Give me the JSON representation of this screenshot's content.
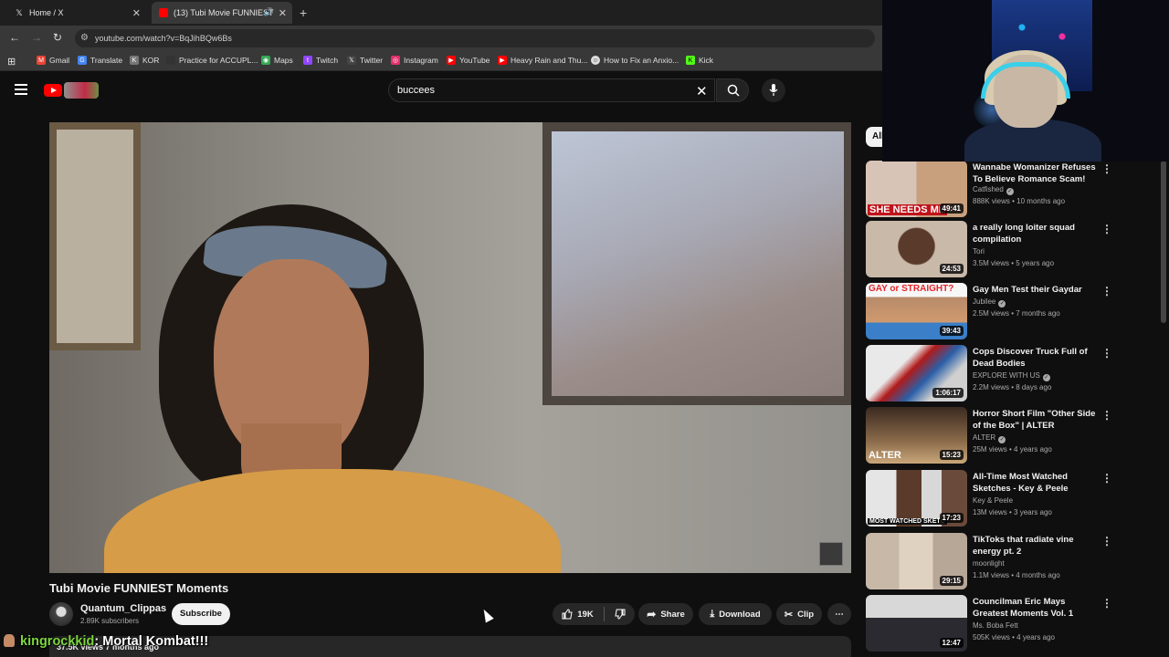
{
  "browser": {
    "tabs": [
      {
        "label": "Home / X"
      },
      {
        "label": "(13) Tubi Movie FUNNIEST"
      }
    ],
    "url": "youtube.com/watch?v=BqJihBQw6Bs",
    "bookmarks": [
      {
        "label": "Gmail",
        "color": "#ea4335"
      },
      {
        "label": "Translate",
        "color": "#4285f4"
      },
      {
        "label": "KOR",
        "color": "#777777"
      },
      {
        "label": "Practice for ACCUPL...",
        "color": "#333333"
      },
      {
        "label": "Maps",
        "color": "#34a853"
      },
      {
        "label": "Twitch",
        "color": "#9146ff"
      },
      {
        "label": "Twitter",
        "color": "#444444"
      },
      {
        "label": "Instagram",
        "color": "#e1306c"
      },
      {
        "label": "YouTube",
        "color": "#ff0000"
      },
      {
        "label": "Heavy Rain and Thu...",
        "color": "#ff0000"
      },
      {
        "label": "How to Fix an Anxio...",
        "color": "#dddddd"
      },
      {
        "label": "Kick",
        "color": "#53fc18"
      }
    ]
  },
  "youtube": {
    "search_value": "buccees",
    "video": {
      "title": "Tubi Movie FUNNIEST Moments",
      "channel": "Quantum_Clippas",
      "subscribers": "2.89K subscribers",
      "subscribe_label": "Subscribe",
      "likes": "19K",
      "share_label": "Share",
      "download_label": "Download",
      "clip_label": "Clip",
      "views_line": "37.5K views  7 months ago"
    },
    "chip_all": "All",
    "recommendations": [
      {
        "title": "Wannabe Womanizer Refuses To Believe Romance Scam!",
        "channel": "Catfished",
        "verified": true,
        "meta": "888K views • 10 months ago",
        "duration": "49:41",
        "thumb_text": "SHE NEEDS ME"
      },
      {
        "title": "a really long loiter squad compilation",
        "channel": "Tori",
        "verified": false,
        "meta": "3.5M views • 5 years ago",
        "duration": "24:53",
        "thumb_text": ""
      },
      {
        "title": "Gay Men Test their Gaydar",
        "channel": "Jubilee",
        "verified": true,
        "meta": "2.5M views • 7 months ago",
        "duration": "39:43",
        "thumb_text": "GAY or STRAIGHT?"
      },
      {
        "title": "Cops Discover Truck Full of Dead Bodies",
        "channel": "EXPLORE WITH US",
        "verified": true,
        "meta": "2.2M views • 8 days ago",
        "duration": "1:06:17",
        "thumb_text": ""
      },
      {
        "title": "Horror Short Film \"Other Side of the Box\" | ALTER",
        "channel": "ALTER",
        "verified": true,
        "meta": "25M views • 4 years ago",
        "duration": "15:23",
        "thumb_text": "ALTER"
      },
      {
        "title": "All-Time Most Watched Sketches - Key & Peele",
        "channel": "Key & Peele",
        "verified": false,
        "meta": "13M views • 3 years ago",
        "duration": "17:23",
        "thumb_text": "MOST WATCHED SKETC"
      },
      {
        "title": "TikToks that radiate vine energy pt. 2",
        "channel": "moonlight",
        "verified": false,
        "meta": "1.1M views • 4 months ago",
        "duration": "29:15",
        "thumb_text": ""
      },
      {
        "title": "Councilman Eric Mays Greatest Moments Vol. 1",
        "channel": "Ms. Boba Fett",
        "verified": false,
        "meta": "505K views • 4 years ago",
        "duration": "12:47",
        "thumb_text": ""
      }
    ]
  },
  "chat": {
    "username": "kingrockkid",
    "message": ": Mortal Kombat!!!"
  }
}
